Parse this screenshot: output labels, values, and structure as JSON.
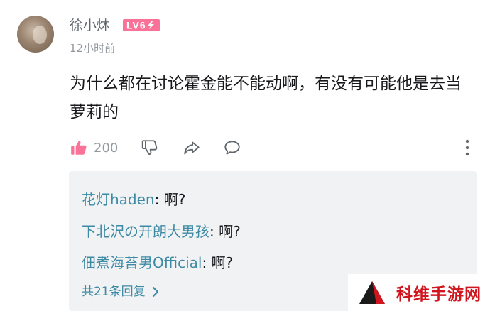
{
  "comment": {
    "username": "徐小炑",
    "level_badge": "LV6",
    "time": "12小时前",
    "text": "为什么都在讨论霍金能不能动啊，有没有可能他是去当萝莉的",
    "likes": "200"
  },
  "replies": [
    {
      "author": "花灯haden",
      "sep": ": ",
      "text": "啊?"
    },
    {
      "author": "下北沢の开朗大男孩",
      "sep": ": ",
      "text": "啊?"
    },
    {
      "author": "佃煮海苔男Official",
      "sep": ": ",
      "text": "啊?"
    }
  ],
  "replies_total": "共21条回复",
  "watermark": "科维手游网",
  "colors": {
    "link": "#3d8aa5",
    "like_pink": "#fb7299",
    "badge": "#fb7299",
    "watermark_red": "#d0151e"
  },
  "icons": [
    "thumbs-up-icon",
    "thumbs-down-icon",
    "share-icon",
    "comment-icon",
    "more-vertical-icon",
    "chevron-right-icon",
    "triangle-logo-icon"
  ]
}
